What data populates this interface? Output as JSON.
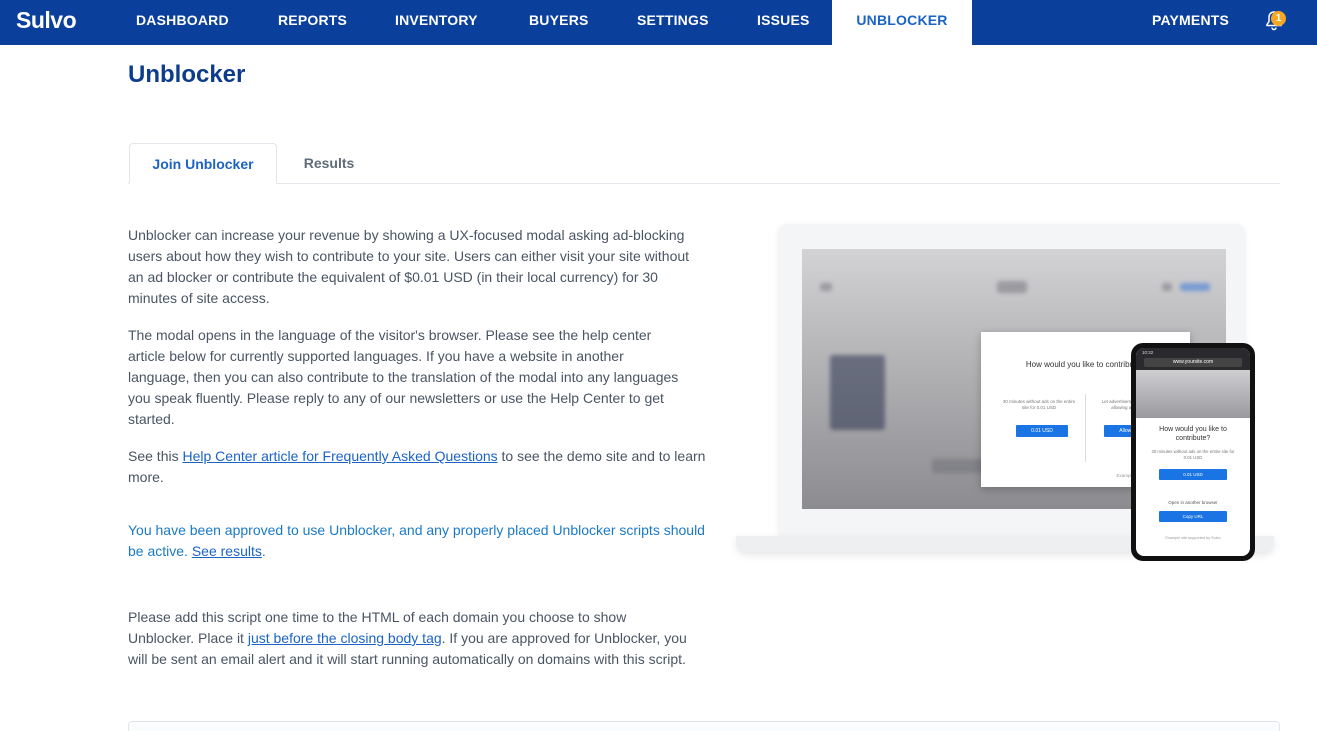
{
  "nav": {
    "logo": "Sulvo",
    "items": [
      {
        "label": "DASHBOARD"
      },
      {
        "label": "REPORTS"
      },
      {
        "label": "INVENTORY"
      },
      {
        "label": "BUYERS"
      },
      {
        "label": "SETTINGS"
      },
      {
        "label": "ISSUES"
      },
      {
        "label": "UNBLOCKER"
      }
    ],
    "payments": "PAYMENTS",
    "notification_count": "1"
  },
  "page": {
    "title": "Unblocker",
    "tabs": [
      {
        "label": "Join Unblocker"
      },
      {
        "label": "Results"
      }
    ]
  },
  "content": {
    "p1": "Unblocker can increase your revenue by showing a UX-focused modal asking ad-blocking users about how they wish to contribute to your site. Users can either visit your site without an ad blocker or contribute the equivalent of $0.01 USD (in their local currency) for 30 minutes of site access.",
    "p2": "The modal opens in the language of the visitor's browser. Please see the help center article below for currently supported languages. If you have a website in another language, then you can also contribute to the translation of the modal into any languages you speak fluently. Please reply to any of our newsletters or use the Help Center to get started.",
    "p3_before": "See this ",
    "p3_link": "Help Center article for Frequently Asked Questions",
    "p3_after": " to see the demo site and to learn more.",
    "approved_text": "You have been approved to use Unblocker, and any properly placed Unblocker scripts should be active. ",
    "approved_link": "See results",
    "approved_end": ".",
    "p4_before": "Please add this script one time to the HTML of each domain you choose to show Unblocker. Place it ",
    "p4_link": "just before the closing body tag",
    "p4_after": ". If you are approved for Unblocker, you will be sent an email alert and it will start running automatically on domains with this script."
  },
  "illustration": {
    "modal_title": "How would you like to contribute?",
    "left_option": "30 minutes without ads on the entire site for 0.01 USD",
    "right_option": "Let advertisers pay for my visit by allowing ads on this site",
    "left_button": "0.01 USD",
    "right_button": "Allow ads",
    "footer": "Example site supported by Sulvo",
    "phone_url": "www.yoursite.com",
    "phone_status": "10:32",
    "phone_title": "How would you like to contribute?",
    "phone_sub": "30 minutes without ads on the entire site for 0.01 USD",
    "phone_btn1": "0.01 USD",
    "phone_open": "Open in another browser",
    "phone_btn2": "Copy URL",
    "phone_footer": "Example site supported by Sulvo"
  },
  "colors": {
    "nav_bg": "#0a3f9c",
    "accent": "#1b63c6",
    "badge": "#f5a623"
  }
}
